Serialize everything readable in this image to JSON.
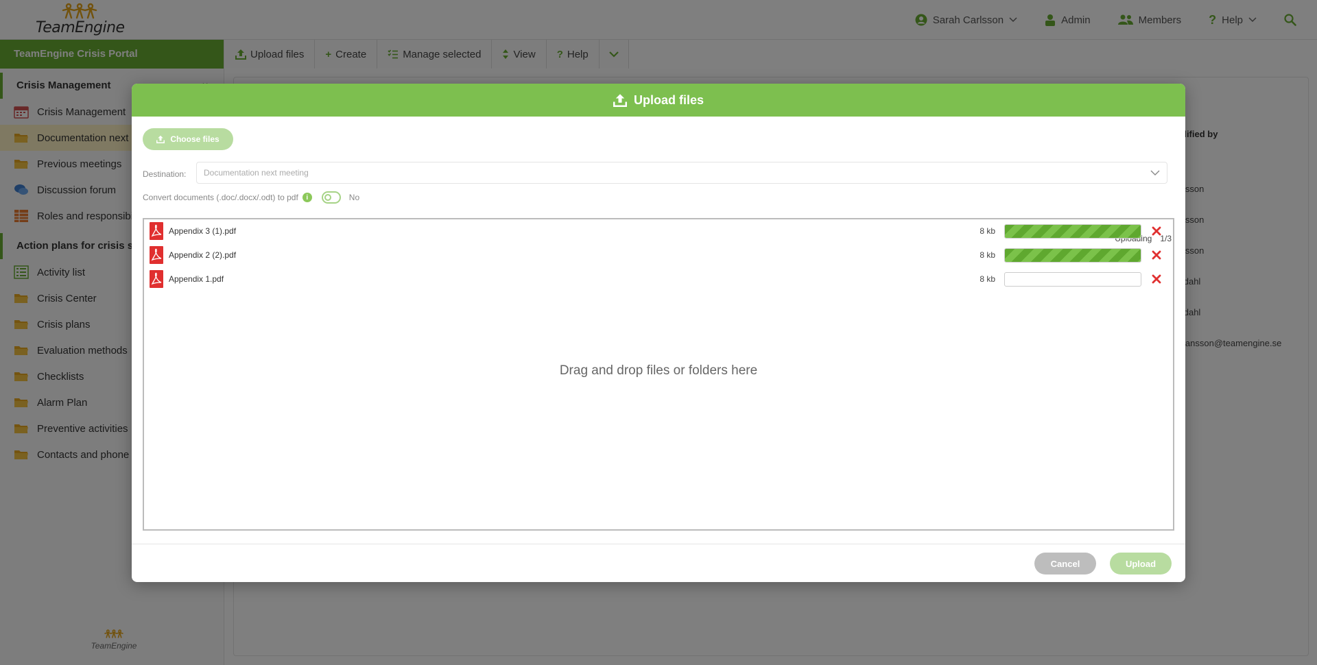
{
  "header": {
    "logo_text": "TeamEngine",
    "user_name": "Sarah Carlsson",
    "admin_label": "Admin",
    "members_label": "Members",
    "help_label": "Help"
  },
  "sidebar": {
    "portal_title": "TeamEngine Crisis Portal",
    "sections": [
      {
        "title": "Crisis Management",
        "items": [
          {
            "label": "Crisis Management",
            "icon": "calendar-icon"
          },
          {
            "label": "Documentation next meeting",
            "icon": "folder-icon"
          },
          {
            "label": "Previous meetings",
            "icon": "folder-icon"
          },
          {
            "label": "Discussion forum",
            "icon": "chat-icon"
          },
          {
            "label": "Roles and responsibilities",
            "icon": "grid-icon"
          }
        ]
      },
      {
        "title": "Action plans for crisis situations",
        "items": [
          {
            "label": "Activity list",
            "icon": "list-icon"
          },
          {
            "label": "Crisis Center",
            "icon": "folder-icon"
          },
          {
            "label": "Crisis plans",
            "icon": "folder-icon"
          },
          {
            "label": "Evaluation methods",
            "icon": "folder-icon"
          },
          {
            "label": "Checklists",
            "icon": "folder-icon"
          },
          {
            "label": "Alarm Plan",
            "icon": "folder-icon"
          },
          {
            "label": "Preventive activities",
            "icon": "folder-icon"
          },
          {
            "label": "Contacts and phone numbers",
            "icon": "folder-icon"
          }
        ]
      }
    ],
    "footer_text": "TeamEngine"
  },
  "toolbar": {
    "upload": "Upload files",
    "create": "Create",
    "manage": "Manage selected",
    "view": "View",
    "help": "Help"
  },
  "background_table": {
    "col_head": "dified by",
    "rows": [
      "ah Carlsson",
      "ah Carlsson",
      "ah Carlsson",
      "e Gröndahl",
      "e Gröndahl",
      "tian.johansson@teamengine.se"
    ]
  },
  "modal": {
    "title": "Upload files",
    "choose_files": "Choose files",
    "destination_label": "Destination:",
    "destination_value": "Documentation next meeting",
    "convert_label": "Convert documents (.doc/.docx/.odt) to pdf",
    "convert_value": "No",
    "uploading_label": "Uploading",
    "uploading_count": "1/3",
    "files": [
      {
        "name": "Appendix 3 (1).pdf",
        "size": "8 kb",
        "progress": 1.0
      },
      {
        "name": "Appendix 2 (2).pdf",
        "size": "8 kb",
        "progress": 1.0
      },
      {
        "name": "Appendix 1.pdf",
        "size": "8 kb",
        "progress": 0.0
      }
    ],
    "drop_text": "Drag and drop files or folders here",
    "cancel": "Cancel",
    "upload": "Upload"
  },
  "colors": {
    "brand_green": "#69ad33",
    "modal_header": "#7dbf4f",
    "remove_red": "#e03030",
    "pdf_red": "#e02f2f"
  }
}
